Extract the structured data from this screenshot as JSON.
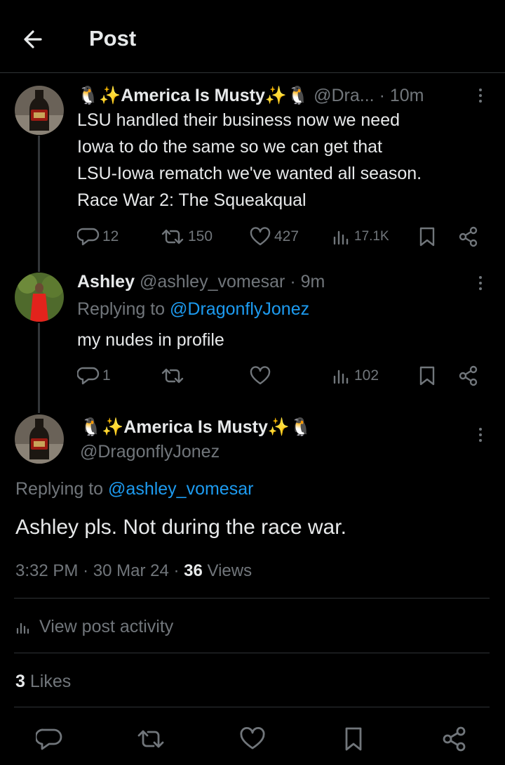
{
  "header": {
    "title": "Post"
  },
  "tweet1": {
    "display_name": "🐧✨America Is Musty✨🐧",
    "handle": "@Dra...",
    "time": "· 10m",
    "lines": [
      "LSU handled their business now we need",
      "Iowa to do the same so we can get that",
      "LSU-Iowa rematch we've wanted all season.",
      "Race War 2: The Squeakqual"
    ],
    "replies": "12",
    "reposts": "150",
    "likes": "427",
    "views": "17.1K"
  },
  "tweet2": {
    "display_name": "Ashley",
    "handle": "@ashley_vomesar",
    "time": "· 9m",
    "replying_label": "Replying to",
    "replying_to": "@DragonflyJonez",
    "text": "my nudes in profile",
    "replies": "1",
    "views": "102"
  },
  "main_post": {
    "display_name": "🐧✨America Is Musty✨🐧",
    "handle": "@DragonflyJonez",
    "replying_label": "Replying to",
    "replying_to": "@ashley_vomesar",
    "text": "Ashley pls. Not during the race war.",
    "time": "3:32 PM",
    "date": "30 Mar 24",
    "dot": "·",
    "views_count": "36",
    "views_label": "Views",
    "activity_label": "View post activity",
    "likes_count": "3",
    "likes_label": "Likes"
  },
  "colors": {
    "background": "#000000",
    "text": "#e7e9ea",
    "muted": "#71767b",
    "link": "#1d9bf0",
    "divider": "#2f3336"
  }
}
